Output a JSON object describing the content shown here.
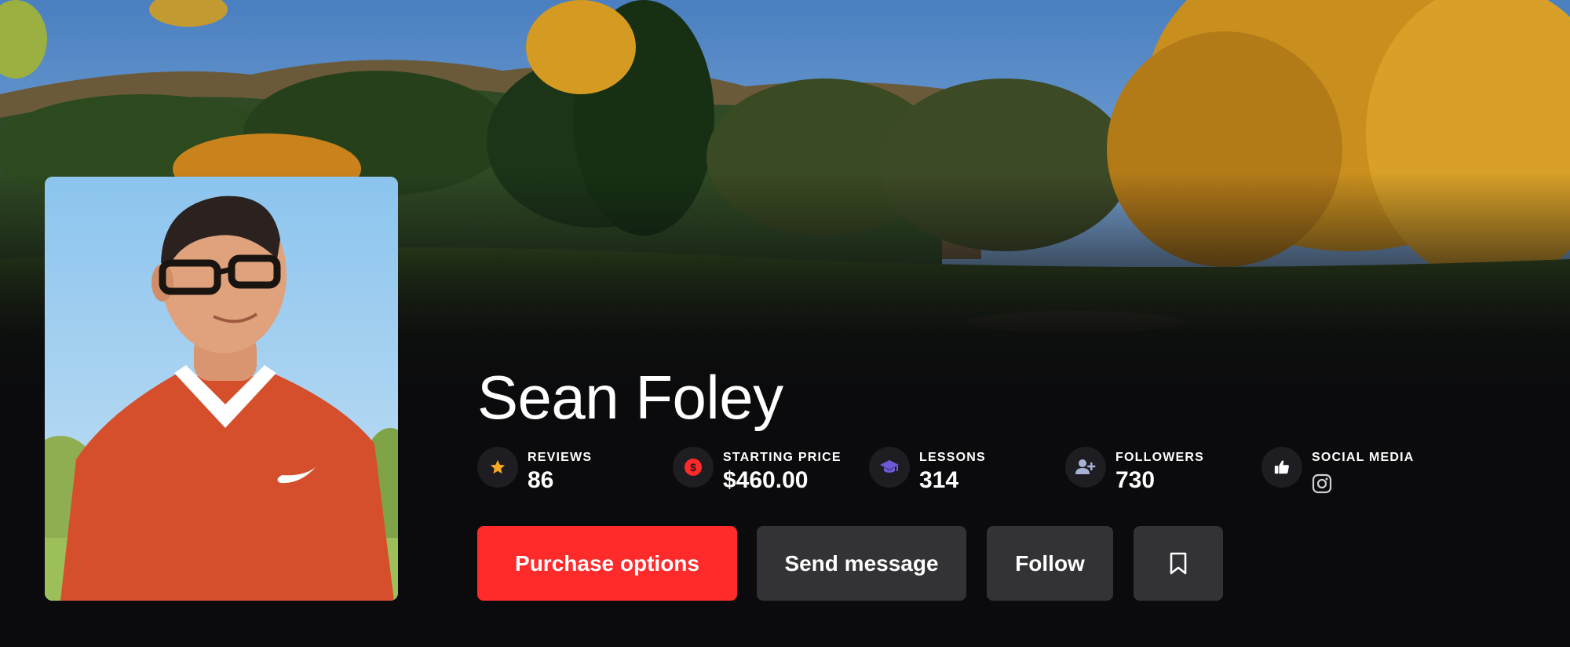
{
  "coach": {
    "name": "Sean Foley"
  },
  "stats": [
    {
      "label": "REVIEWS",
      "value": "86",
      "icon": "star-icon",
      "icon_color": "#f6a723"
    },
    {
      "label": "STARTING PRICE",
      "value": "$460.00",
      "icon": "dollar-icon",
      "icon_color": "#ff2a2a"
    },
    {
      "label": "LESSONS",
      "value": "314",
      "icon": "graduation-cap-icon",
      "icon_color": "#6a5ad8"
    },
    {
      "label": "FOLLOWERS",
      "value": "730",
      "icon": "add-user-icon",
      "icon_color": "#a8b2d6"
    },
    {
      "label": "SOCIAL MEDIA",
      "value": "",
      "icon": "thumbs-up-icon",
      "icon_color": "#ffffff",
      "links": [
        "instagram-icon"
      ]
    }
  ],
  "actions": {
    "purchase_label": "Purchase options",
    "message_label": "Send message",
    "follow_label": "Follow",
    "bookmark_icon": "bookmark-icon"
  },
  "colors": {
    "accent": "#ff2a2a",
    "background": "#0b0b0d",
    "secondary_button": "#333336"
  }
}
